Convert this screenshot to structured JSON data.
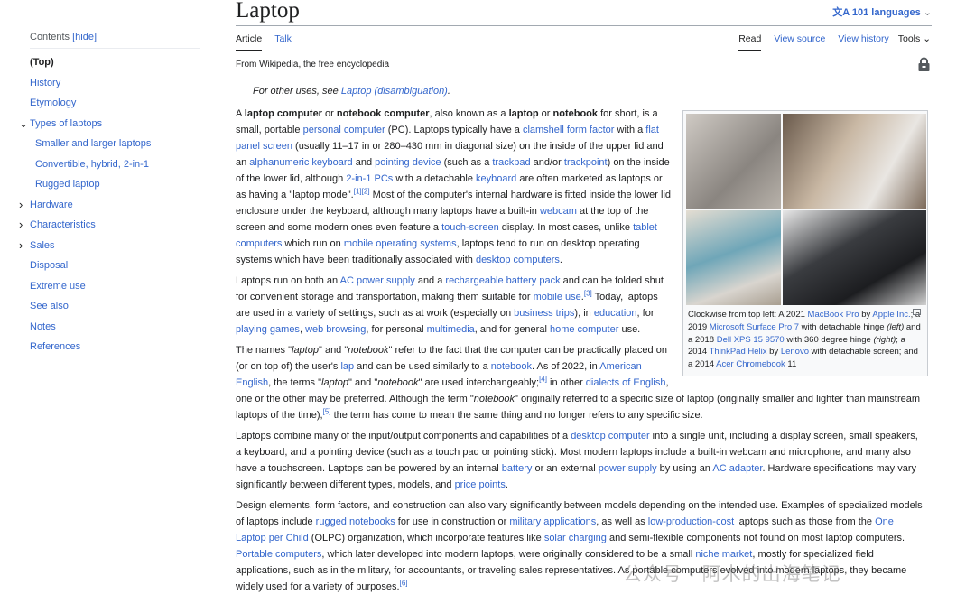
{
  "toc": {
    "heading": "Contents",
    "hide": "[hide]",
    "items": [
      {
        "label": "(Top)",
        "level": 0,
        "top": true
      },
      {
        "label": "History",
        "level": 0
      },
      {
        "label": "Etymology",
        "level": 0
      },
      {
        "label": "Types of laptops",
        "level": 0,
        "chevron": "chevron-down"
      },
      {
        "label": "Smaller and larger laptops",
        "level": 1
      },
      {
        "label": "Convertible, hybrid, 2-in-1",
        "level": 1
      },
      {
        "label": "Rugged laptop",
        "level": 1
      },
      {
        "label": "Hardware",
        "level": 0,
        "chevron": "chevron-right"
      },
      {
        "label": "Characteristics",
        "level": 0,
        "chevron": "chevron-right"
      },
      {
        "label": "Sales",
        "level": 0,
        "chevron": "chevron-right"
      },
      {
        "label": "Disposal",
        "level": 0
      },
      {
        "label": "Extreme use",
        "level": 0
      },
      {
        "label": "See also",
        "level": 0
      },
      {
        "label": "Notes",
        "level": 0
      },
      {
        "label": "References",
        "level": 0
      }
    ]
  },
  "header": {
    "title": "Laptop",
    "languages": "101 languages",
    "tabs_left": [
      "Article",
      "Talk"
    ],
    "tabs_right": [
      "Read",
      "View source",
      "View history",
      "Tools"
    ],
    "from": "From Wikipedia, the free encyclopedia"
  },
  "hatnote": {
    "text": "For other uses, see ",
    "link": "Laptop (disambiguation)",
    "end": "."
  },
  "infobox": {
    "caption": [
      "Clockwise from top left: A 2021 ",
      {
        "l": "MacBook Pro"
      },
      " by ",
      {
        "l": "Apple Inc."
      },
      "; a 2019 ",
      {
        "l": "Microsoft Surface Pro 7"
      },
      " with detachable hinge ",
      {
        "i": "(left)"
      },
      " and a 2018 ",
      {
        "l": "Dell XPS 15 9570"
      },
      " with 360 degree hinge ",
      {
        "i": "(right)"
      },
      "; a 2014 ",
      {
        "l": "ThinkPad Helix"
      },
      " by ",
      {
        "l": "Lenovo"
      },
      " with detachable screen; and a 2014 ",
      {
        "l": "Acer Chromebook"
      },
      " 11"
    ]
  },
  "paragraphs": [
    [
      "A ",
      {
        "b": "laptop computer"
      },
      " or ",
      {
        "b": "notebook computer"
      },
      ", also known as a ",
      {
        "b": "laptop"
      },
      " or ",
      {
        "b": "notebook"
      },
      " for short, is a small, portable ",
      {
        "l": "personal computer"
      },
      " (PC). Laptops typically have a ",
      {
        "l": "clamshell form factor"
      },
      " with a ",
      {
        "l": "flat panel screen"
      },
      " (usually 11–17 in or 280–430 mm in diagonal size) on the inside of the upper lid and an ",
      {
        "l": "alphanumeric keyboard"
      },
      " and ",
      {
        "l": "pointing device"
      },
      " (such as a ",
      {
        "l": "trackpad"
      },
      " and/or ",
      {
        "l": "trackpoint"
      },
      ") on the inside of the lower lid, although ",
      {
        "l": "2-in-1 PCs"
      },
      " with a detachable ",
      {
        "l": "keyboard"
      },
      " are often marketed as laptops or as having a \"laptop mode\".",
      {
        "s": "[1]"
      },
      {
        "s": "[2]"
      },
      " Most of the computer's internal hardware is fitted inside the lower lid enclosure under the keyboard, although many laptops have a built-in ",
      {
        "l": "webcam"
      },
      " at the top of the screen and some modern ones even feature a ",
      {
        "l": "touch-screen"
      },
      " display. In most cases, unlike ",
      {
        "l": "tablet computers"
      },
      " which run on ",
      {
        "l": "mobile operating systems"
      },
      ", laptops tend to run on desktop operating systems which have been traditionally associated with ",
      {
        "l": "desktop computers"
      },
      "."
    ],
    [
      "Laptops run on both an ",
      {
        "l": "AC power supply"
      },
      " and a ",
      {
        "l": "rechargeable battery pack"
      },
      " and can be folded shut for convenient storage and transportation, making them suitable for ",
      {
        "l": "mobile use"
      },
      ".",
      {
        "s": "[3]"
      },
      " Today, laptops are used in a variety of settings, such as at work (especially on ",
      {
        "l": "business trips"
      },
      "), in ",
      {
        "l": "education"
      },
      ", for ",
      {
        "l": "playing games"
      },
      ", ",
      {
        "l": "web browsing"
      },
      ", for personal ",
      {
        "l": "multimedia"
      },
      ", and for general ",
      {
        "l": "home computer"
      },
      " use."
    ],
    [
      "The names \"",
      {
        "i": "laptop"
      },
      "\" and \"",
      {
        "i": "notebook"
      },
      "\" refer to the fact that the computer can be practically placed on (or on top of) the user's ",
      {
        "l": "lap"
      },
      " and can be used similarly to a ",
      {
        "l": "notebook"
      },
      ". As of 2022, in ",
      {
        "l": "American English"
      },
      ", the terms \"",
      {
        "i": "laptop"
      },
      "\" and \"",
      {
        "i": "notebook"
      },
      "\" are used interchangeably;",
      {
        "s": "[4]"
      },
      " in other ",
      {
        "l": "dialects of English"
      },
      ", one or the other may be preferred. Although the term \"",
      {
        "i": "notebook"
      },
      "\" originally referred to a specific size of laptop (originally smaller and lighter than mainstream laptops of the time),",
      {
        "s": "[5]"
      },
      " the term has come to mean the same thing and no longer refers to any specific size."
    ],
    [
      "Laptops combine many of the input/output components and capabilities of a ",
      {
        "l": "desktop computer"
      },
      " into a single unit, including a display screen, small speakers, a keyboard, and a pointing device (such as a touch pad or pointing stick). Most modern laptops include a built-in webcam and microphone, and many also have a touchscreen. Laptops can be powered by an internal ",
      {
        "l": "battery"
      },
      " or an external ",
      {
        "l": "power supply"
      },
      " by using an ",
      {
        "l": "AC adapter"
      },
      ". Hardware specifications may vary significantly between different types, models, and ",
      {
        "l": "price points"
      },
      "."
    ],
    [
      "Design elements, form factors, and construction can also vary significantly between models depending on the intended use. Examples of specialized models of laptops include ",
      {
        "l": "rugged notebooks"
      },
      " for use in construction or ",
      {
        "l": "military applications"
      },
      ", as well as ",
      {
        "l": "low-production-cost"
      },
      " laptops such as those from the ",
      {
        "l": "One Laptop per Child"
      },
      " (OLPC) organization, which incorporate features like ",
      {
        "l": "solar charging"
      },
      " and semi-flexible components not found on most laptop computers. ",
      {
        "l": "Portable computers"
      },
      ", which later developed into modern laptops, were originally considered to be a small ",
      {
        "l": "niche market"
      },
      ", mostly for specialized field applications, such as in the military, for accountants, or traveling sales representatives. As portable computers evolved into modern laptops, they became widely used for a variety of purposes.",
      {
        "s": "[6]"
      }
    ]
  ],
  "watermark": "公众号 · 阿木的出海笔记",
  "colors": {
    "link": "#3366cc",
    "text": "#202122"
  }
}
